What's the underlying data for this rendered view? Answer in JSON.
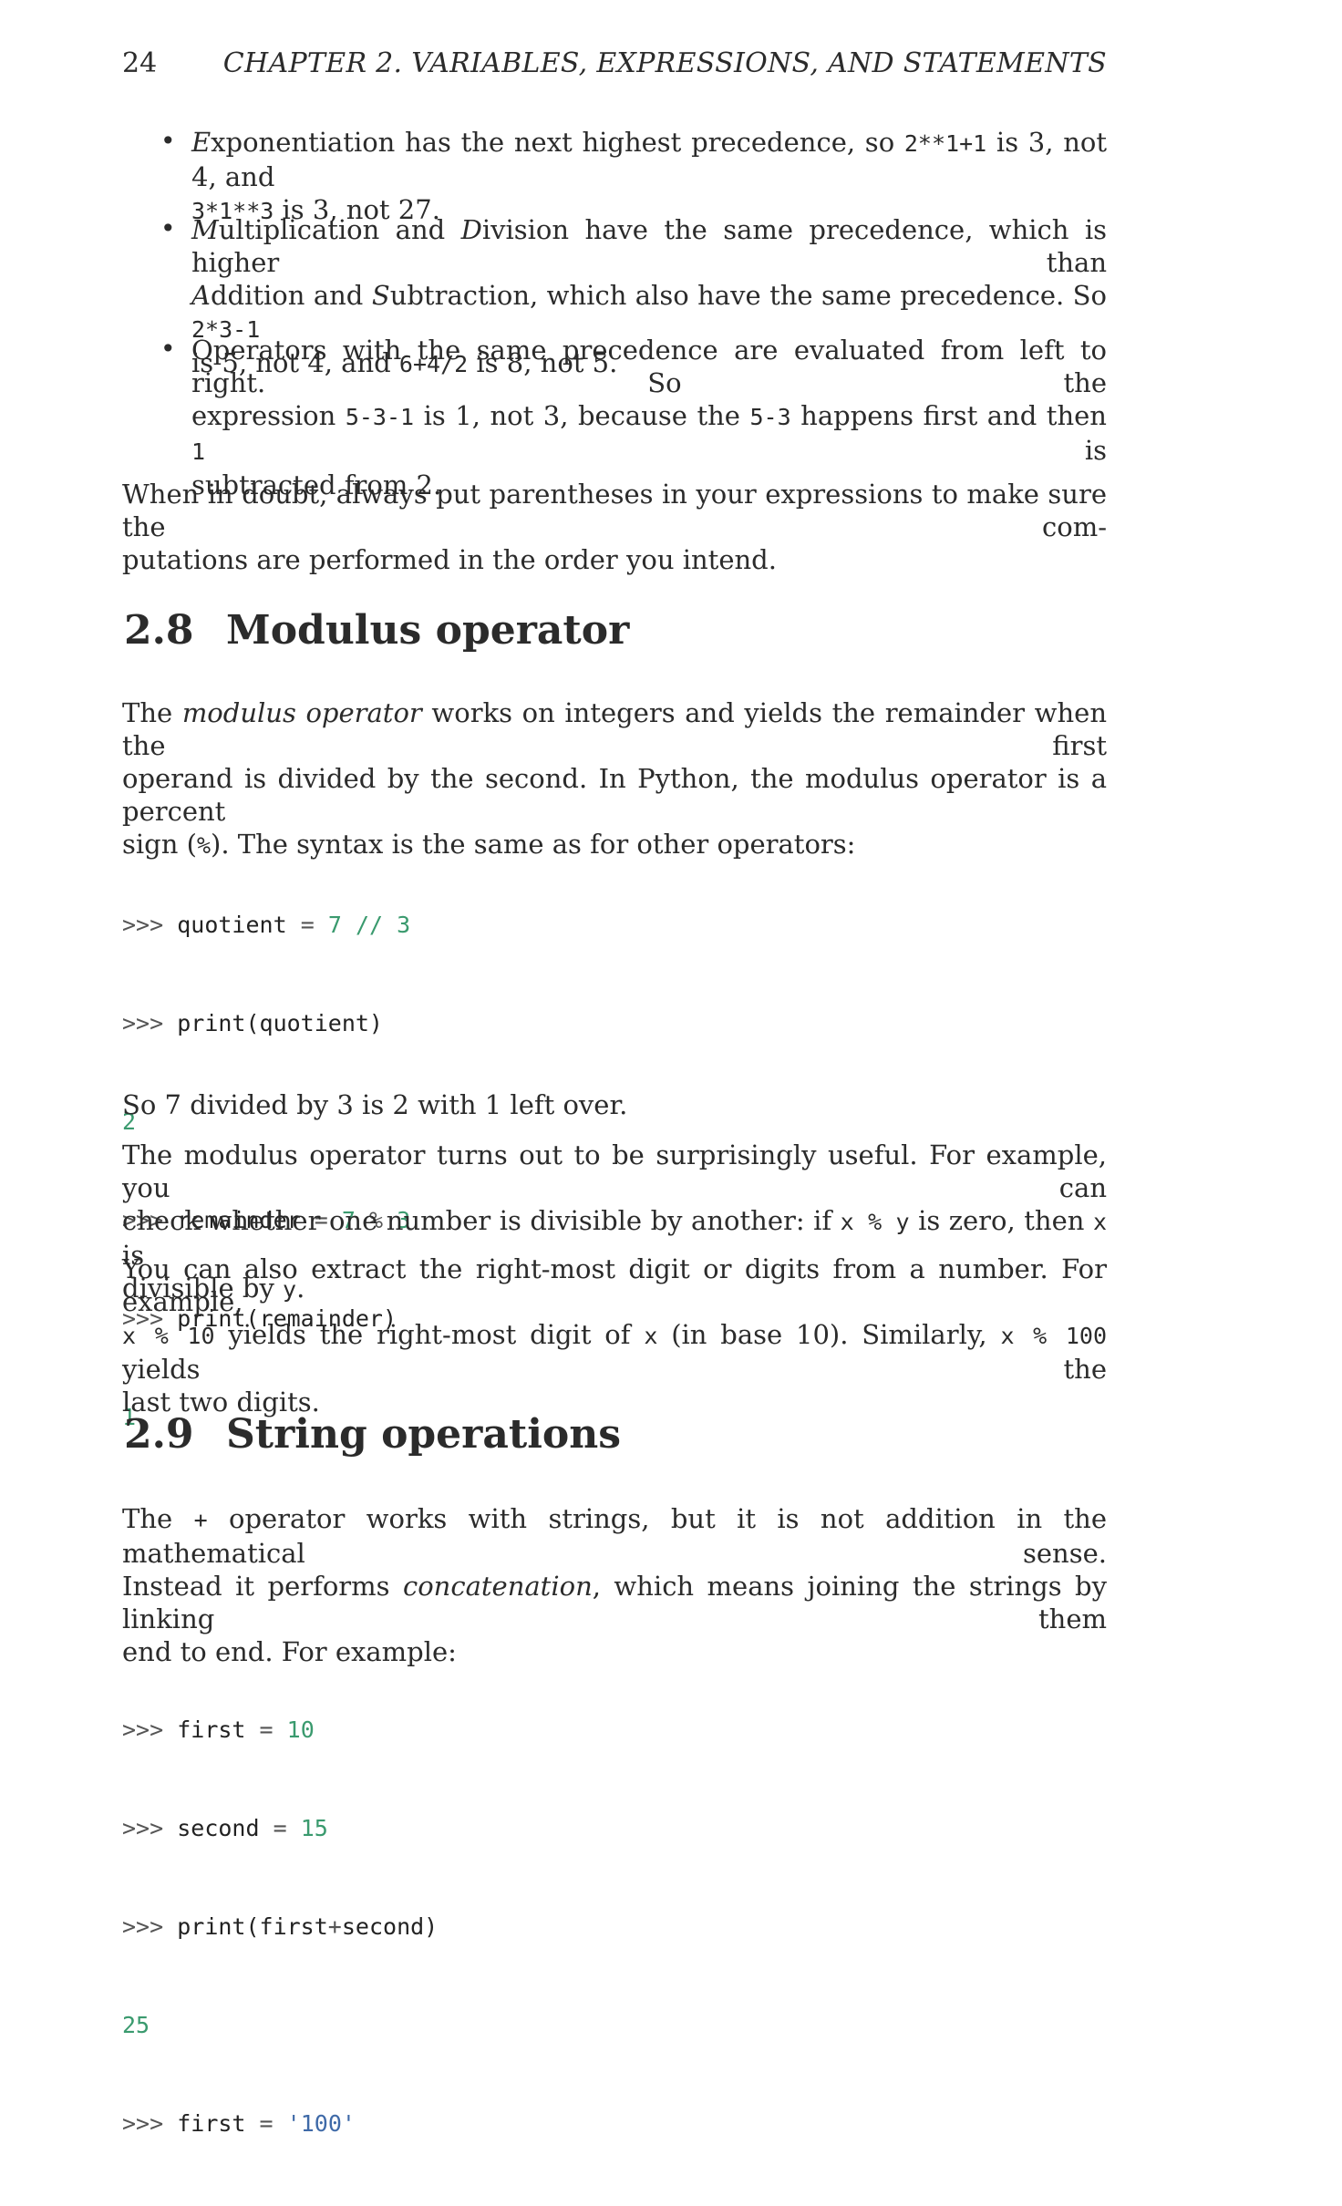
{
  "header": {
    "page_number": "24",
    "running_title": "CHAPTER 2.  VARIABLES, EXPRESSIONS, AND STATEMENTS"
  },
  "bullets": [
    {
      "lead": "E",
      "t1": "xponentiation has the next highest precedence, so ",
      "c1": "2**1+1",
      "t2": " is 3, not 4, and",
      "c2": "3*1**3",
      "t3": " is 3, not 27."
    },
    {
      "lead": "M",
      "t1": "ultiplication and ",
      "lead2": "D",
      "t2": "ivision have the same precedence, which is higher than",
      "lead3": "A",
      "t3": "ddition and ",
      "lead4": "S",
      "t4": "ubtraction, which also have the same precedence. So ",
      "c1": "2*3-1",
      "t5": "is 5, not 4, and ",
      "c2": "6+4/2",
      "t6": " is 8, not 5."
    },
    {
      "t1": "Operators with the same precedence are evaluated from left to right. So the",
      "t2": "expression ",
      "c1": "5-3-1",
      "t3": " is 1, not 3, because the ",
      "c2": "5-3",
      "t4": " happens first and then ",
      "c3": "1",
      "t5": " is",
      "t6": "subtracted from 2."
    }
  ],
  "doubt_para": {
    "line1": "When in doubt, always put parentheses in your expressions to make sure the com-",
    "line2": "putations are performed in the order you intend."
  },
  "section_28": {
    "number": "2.8",
    "title": "Modulus operator"
  },
  "modulus_para": {
    "t1": "The ",
    "em1": "modulus operator",
    "t2": " works on integers and yields the remainder when the first",
    "line2": "operand is divided by the second. In Python, the modulus operator is a percent",
    "t3": "sign (",
    "c1": "%",
    "t4": "). The syntax is the same as for other operators:"
  },
  "code1": {
    "prompt": ">>>",
    "l1_var": "quotient",
    "l1_eq": "=",
    "l1_a": "7",
    "l1_op": "//",
    "l1_b": "3",
    "l2": "print(quotient)",
    "l3_out": "2",
    "l4_var": "remainder",
    "l4_eq": "=",
    "l4_a": "7",
    "l4_op": "%",
    "l4_b": "3",
    "l5": "print(remainder)",
    "l6_out": "1"
  },
  "so7_para": "So 7 divided by 3 is 2 with 1 left over.",
  "useful_para": {
    "line1": "The modulus operator turns out to be surprisingly useful. For example, you can",
    "t1": "check whether one number is divisible by another: if ",
    "c1": "x % y",
    "t2": " is zero, then ",
    "c2": "x",
    "t3": " is",
    "t4": "divisible by ",
    "c3": "y",
    "t5": "."
  },
  "extract_para": {
    "line1": "You can also extract the right-most digit or digits from a number. For example,",
    "c1": "x % 10",
    "t1": " yields the right-most digit of ",
    "c2": "x",
    "t2": " (in base 10). Similarly, ",
    "c3": "x % 100",
    "t3": " yields the",
    "line3": "last two digits."
  },
  "section_29": {
    "number": "2.9",
    "title": "String operations"
  },
  "string_para": {
    "t1": "The ",
    "c1": "+",
    "t2": " operator works with strings, but it is not addition in the mathematical sense.",
    "t3": "Instead it performs ",
    "em1": "concatenation",
    "t4": ", which means joining the strings by linking them",
    "line3": "end to end. For example:"
  },
  "code2": {
    "prompt": ">>>",
    "l1_var": "first",
    "l1_eq": "=",
    "l1_val": "10",
    "l2_var": "second",
    "l2_eq": "=",
    "l2_val": "15",
    "l3_a": "print(first",
    "l3_op": "+",
    "l3_b": "second)",
    "l4_out": "25",
    "l5_var": "first",
    "l5_eq": "=",
    "l5_val": "'100'"
  }
}
